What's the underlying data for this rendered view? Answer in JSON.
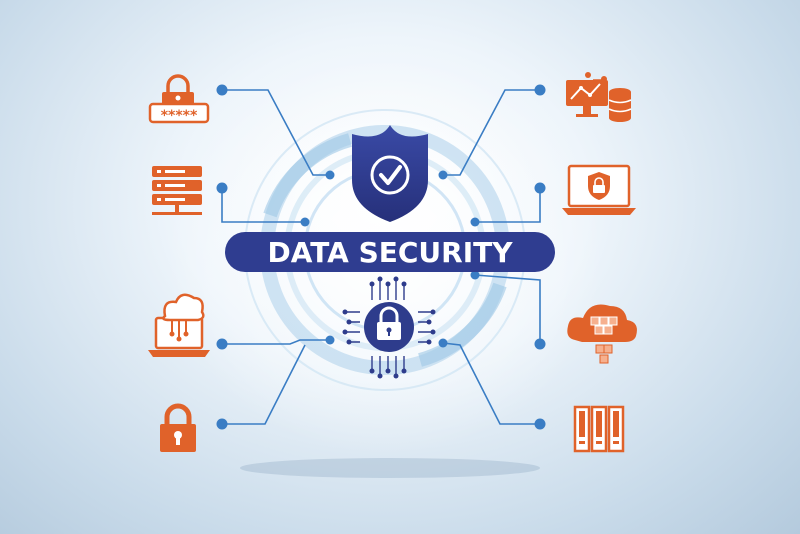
{
  "banner": {
    "title": "DATA SECURITY"
  },
  "colors": {
    "accent_orange": "#e0622a",
    "navy": "#2e3c8c",
    "line_blue": "#3a7dc4",
    "ring_blue": "#b9d8ee"
  },
  "icons": {
    "left": [
      "password-lock-icon",
      "server-stack-icon",
      "cloud-laptop-icon",
      "padlock-icon"
    ],
    "right": [
      "analytics-database-icon",
      "laptop-shield-icon",
      "cloud-blocks-icon",
      "server-rack-icon"
    ],
    "center": [
      "shield-check-icon",
      "circuit-lock-icon"
    ]
  }
}
